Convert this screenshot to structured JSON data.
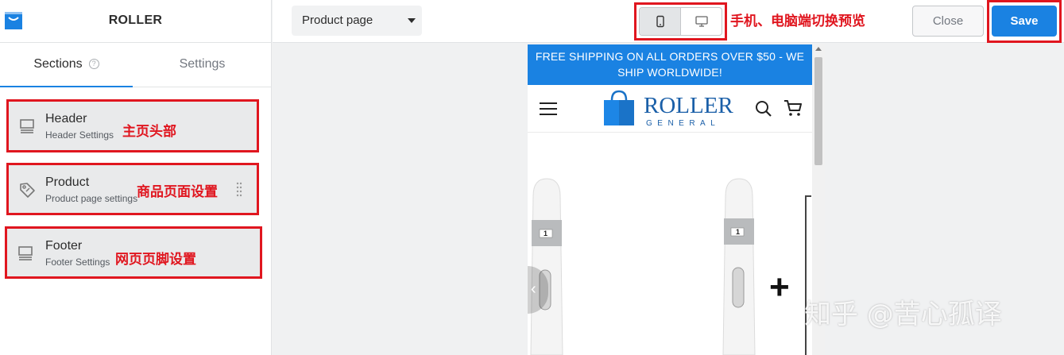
{
  "app": {
    "title": "ROLLER"
  },
  "sidebar": {
    "tabs": [
      {
        "label": "Sections",
        "active": true
      },
      {
        "label": "Settings",
        "active": false
      }
    ],
    "sections": [
      {
        "title": "Header",
        "subtitle": "Header Settings",
        "icon": "layout-header-icon",
        "note": "主页头部"
      },
      {
        "title": "Product",
        "subtitle": "Product page settings",
        "icon": "price-tag-icon",
        "note": "商品页面设置"
      },
      {
        "title": "Footer",
        "subtitle": "Footer Settings",
        "icon": "layout-footer-icon",
        "note": "网页页脚设置"
      }
    ]
  },
  "topbar": {
    "page_select": {
      "value": "Product page"
    },
    "device_toggle": {
      "active": "mobile",
      "options": [
        "mobile",
        "desktop"
      ],
      "note": "手机、电脑端切换预览"
    },
    "close_label": "Close",
    "save_label": "Save"
  },
  "preview": {
    "announcement": "FREE SHIPPING ON ALL ORDERS OVER $50 - WE SHIP WORLDWIDE!",
    "store_logo": {
      "name": "ROLLER",
      "tagline": "GENERAL"
    },
    "pen_label": "1"
  },
  "overlay": {
    "watermark": "知乎 @苦心孤译"
  },
  "colors": {
    "accent": "#1a82e2",
    "annotation": "#e0161f"
  }
}
